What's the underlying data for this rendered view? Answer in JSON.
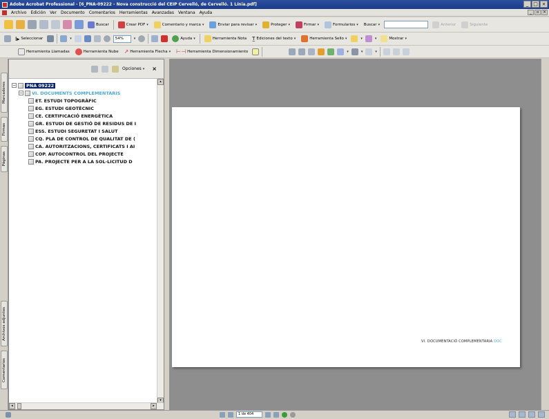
{
  "window": {
    "title": "Adobe Acrobat Professional - [6_PNA-09222 - Nova construcció del CEIP Cervelló, de Cervelló. 1 Línia.pdf]"
  },
  "menu": [
    "Archivo",
    "Edición",
    "Ver",
    "Documento",
    "Comentarios",
    "Herramientas",
    "Avanzadas",
    "Ventana",
    "Ayuda"
  ],
  "toolbar1": {
    "search_label": "Buscar",
    "create_pdf": "Crear PDF",
    "comment_markup": "Comentario y marca",
    "send_review": "Enviar para revisar",
    "protect": "Proteger",
    "sign": "Firmar",
    "forms": "Formularios",
    "find_label": "Buscar",
    "previous": "Anterior",
    "next": "Siguiente"
  },
  "toolbar2": {
    "select": "Seleccionar",
    "zoom_value": "54%",
    "help": "Ayuda",
    "note_tool": "Herramienta Nota",
    "text_edits": "Ediciones del texto",
    "stamp_tool": "Herramienta Sello",
    "show": "Mostrar"
  },
  "toolbar3": {
    "callout_tool": "Herramienta Llamadas",
    "cloud_tool": "Herramienta Nube",
    "arrow_tool": "Herramienta Flecha",
    "dimension_tool": "Herramienta Dimensionamiento"
  },
  "side_tabs": [
    "Marcadores",
    "Firmas",
    "Páginas",
    "Archivos adjuntos",
    "Comentarios"
  ],
  "bookmarks_panel": {
    "options_label": "Opciones",
    "root": "PNA 09222",
    "section": "VI. DOCUMENTS COMPLEMENTARIS",
    "items": [
      "ET. ESTUDI TOPOGRÀFIC",
      "EG. ESTUDI GEOTÈCNIC",
      "CE. CERTIFICACIÓ ENERGÈTICA",
      "GR. ESTUDI DE GESTIÓ DE RESIDUS DE I",
      "ESS. ESTUDI SEGURETAT I SALUT",
      "CQ. PLA DE CONTROL DE QUALITAT DE (",
      "CA. AUTORITZACIONS, CERTIFICATS I AI",
      "COP. AUTOCONTROL DEL PROJECTE",
      "PA. PROJECTE PER A LA SOL·LICITUD D"
    ]
  },
  "page_content": {
    "footer_text": "VI. DOCUMENTACIÓ COMPLEMENTARIA",
    "footer_code": "DOC"
  },
  "status": {
    "page_indicator": "1 de 404"
  },
  "colors": {
    "accent_blue": "#4aa8d8",
    "selection": "#0a246a",
    "doc_background": "#8e8e8e"
  }
}
